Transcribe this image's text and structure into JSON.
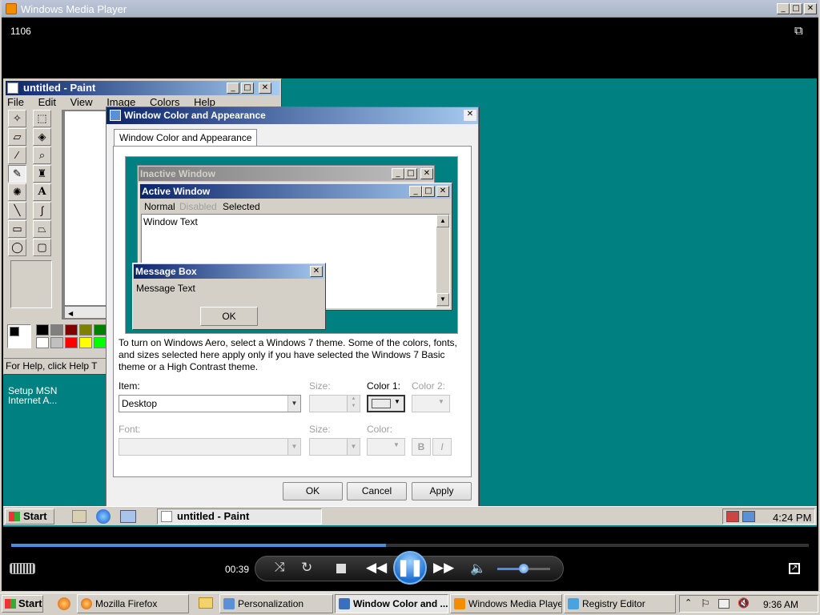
{
  "wmp": {
    "title": "Windows Media Player",
    "counter": "1106",
    "time": "00:39",
    "progress": 0.47,
    "volume": 0.5
  },
  "paint": {
    "title": "untitled - Paint",
    "menu": [
      "File",
      "Edit",
      "View",
      "Image",
      "Colors",
      "Help"
    ],
    "status": "For Help, click Help T"
  },
  "desktop": {
    "icon_label_1": "Setup MSN",
    "icon_label_2": "Internet A..."
  },
  "dialog": {
    "title": "Window Color and Appearance",
    "tab": "Window Color and Appearance",
    "preview": {
      "inactive_title": "Inactive Window",
      "active_title": "Active Window",
      "menu_normal": "Normal",
      "menu_disabled": "Disabled",
      "menu_selected": "Selected",
      "window_text": "Window Text",
      "msgbox_title": "Message Box",
      "msgbox_text": "Message Text",
      "msgbox_ok": "OK"
    },
    "info": "To turn on Windows Aero, select a Windows 7 theme.  Some of the colors, fonts, and sizes selected here apply only if you have selected the Windows 7 Basic theme or a High Contrast theme.",
    "item_label": "Item:",
    "item_value": "Desktop",
    "size_label": "Size:",
    "color1_label": "Color 1:",
    "color2_label": "Color 2:",
    "font_label": "Font:",
    "size2_label": "Size:",
    "color_label": "Color:",
    "bold": "B",
    "italic": "I",
    "ok": "OK",
    "cancel": "Cancel",
    "apply": "Apply"
  },
  "inner_taskbar": {
    "start": "Start",
    "task": "untitled - Paint",
    "clock": "4:24 PM"
  },
  "taskbar": {
    "start": "Start",
    "items": [
      "Mozilla Firefox",
      "Personalization",
      "Window Color and ...",
      "Windows Media Player",
      "Registry Editor"
    ],
    "clock": "9:36 AM"
  },
  "colors": {
    "teal": "#008080",
    "xp_active": "#0a246a",
    "xp_active2": "#a6caf0",
    "dialog_bg": "#f0f0f0"
  }
}
